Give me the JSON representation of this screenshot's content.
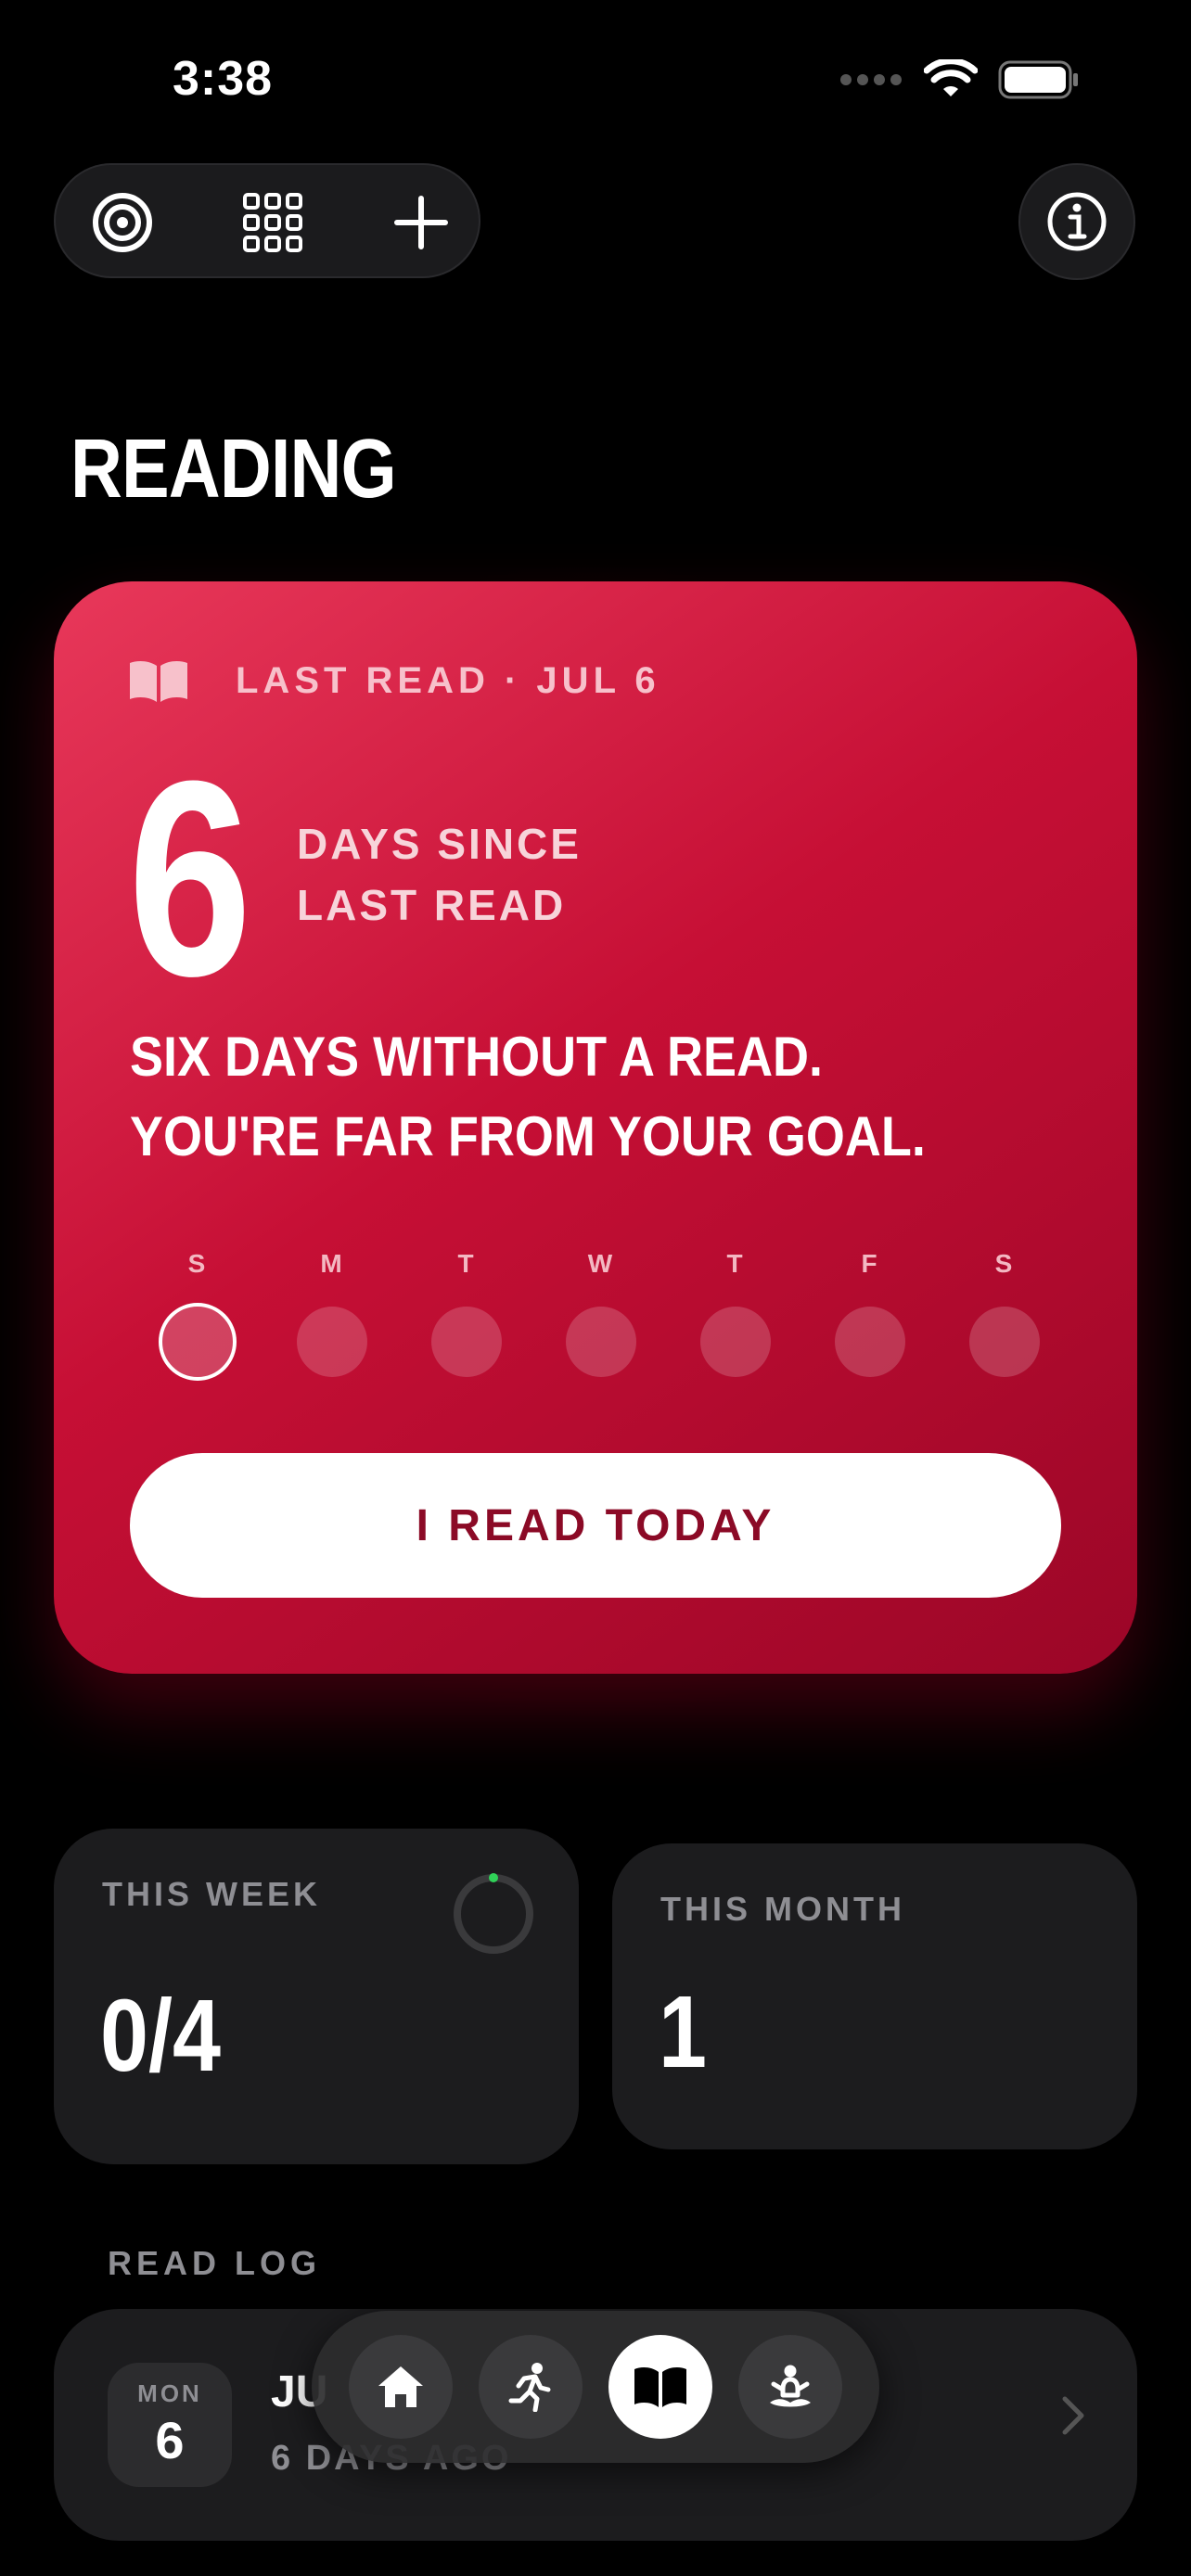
{
  "status_bar": {
    "time": "3:38"
  },
  "page": {
    "title": "READING"
  },
  "hero": {
    "last_read": "LAST READ · JUL 6",
    "days_count": "6",
    "since_line1": "DAYS SINCE",
    "since_line2": "LAST READ",
    "message": "SIX DAYS WITHOUT A READ. YOU'RE FAR FROM YOUR GOAL.",
    "weekdays": [
      "S",
      "M",
      "T",
      "W",
      "T",
      "F",
      "S"
    ],
    "cta_label": "I READ TODAY"
  },
  "stats": {
    "week_label": "THIS WEEK",
    "week_value": "0/4",
    "week_progress": 0,
    "month_label": "THIS MONTH",
    "month_value": "1"
  },
  "read_log": {
    "label": "READ LOG",
    "entries": [
      {
        "dow": "MON",
        "day": "6",
        "title": "JU",
        "subtitle": "6 DAYS AGO"
      }
    ]
  },
  "colors": {
    "accent": "#c60f35",
    "cta_text": "#8b0a26",
    "progress_dot": "#30d158"
  },
  "icons": {
    "toolbar": [
      "target-icon",
      "grid-icon",
      "plus-icon"
    ],
    "info": "info-icon",
    "tabs": [
      "home-icon",
      "running-icon",
      "book-icon",
      "meditation-icon"
    ]
  }
}
